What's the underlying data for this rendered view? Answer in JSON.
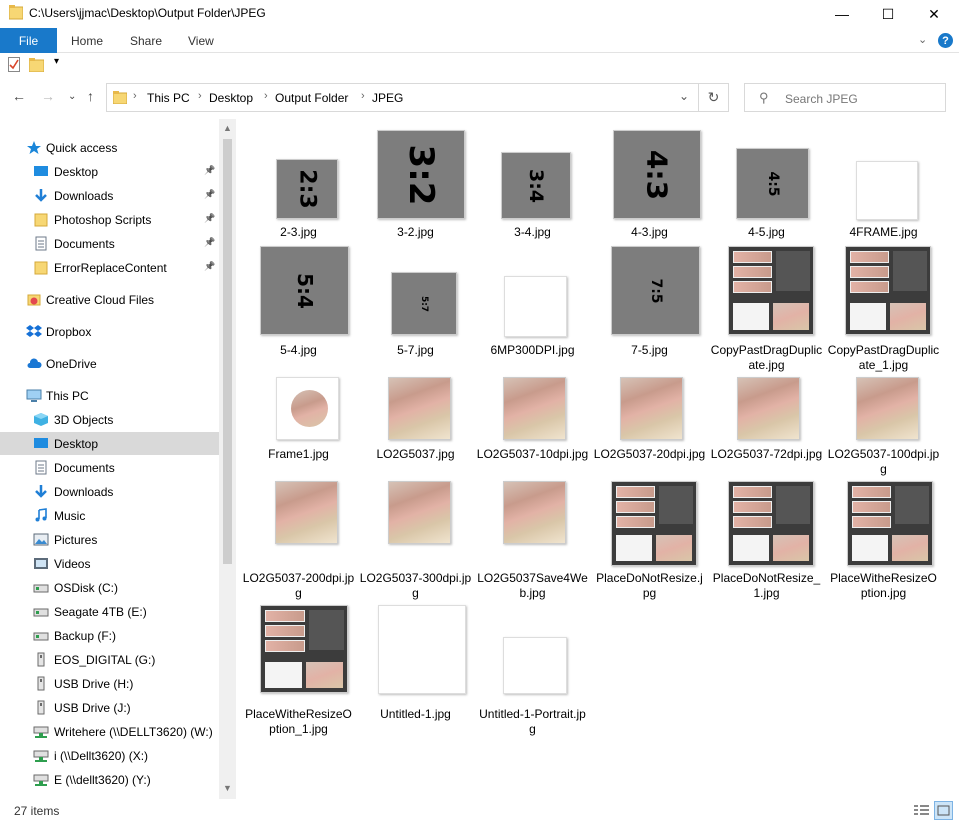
{
  "window": {
    "title": "C:\\Users\\jjmac\\Desktop\\Output Folder\\JPEG",
    "minimize": "—",
    "maximize": "☐",
    "close": "✕"
  },
  "ribbon": {
    "tabs": [
      "File",
      "Home",
      "Share",
      "View"
    ],
    "help": "?"
  },
  "address": {
    "crumbs": [
      "This PC",
      "Desktop",
      "Output Folder",
      "JPEG"
    ],
    "search_placeholder": "Search JPEG"
  },
  "sidebar": {
    "items": [
      {
        "label": "Quick access",
        "icon": "star-icon",
        "pinned": false
      },
      {
        "label": "Desktop",
        "icon": "desktop-icon",
        "pinned": true
      },
      {
        "label": "Downloads",
        "icon": "download-icon",
        "pinned": true
      },
      {
        "label": "Photoshop Scripts",
        "icon": "folder-icon",
        "pinned": true
      },
      {
        "label": "Documents",
        "icon": "documents-icon",
        "pinned": true
      },
      {
        "label": "ErrorReplaceContent",
        "icon": "folder-icon",
        "pinned": true
      },
      {
        "label": "Creative Cloud Files",
        "icon": "creative-cloud-icon",
        "pinned": false
      },
      {
        "label": "Dropbox",
        "icon": "dropbox-icon",
        "pinned": false
      },
      {
        "label": "OneDrive",
        "icon": "cloud-icon",
        "pinned": false
      },
      {
        "label": "This PC",
        "icon": "computer-icon",
        "pinned": false
      },
      {
        "label": "3D Objects",
        "icon": "cube-icon",
        "pinned": false
      },
      {
        "label": "Desktop",
        "icon": "desktop-icon",
        "pinned": false,
        "selected": true
      },
      {
        "label": "Documents",
        "icon": "documents-icon",
        "pinned": false
      },
      {
        "label": "Downloads",
        "icon": "download-icon",
        "pinned": false
      },
      {
        "label": "Music",
        "icon": "music-icon",
        "pinned": false
      },
      {
        "label": "Pictures",
        "icon": "pictures-icon",
        "pinned": false
      },
      {
        "label": "Videos",
        "icon": "video-icon",
        "pinned": false
      },
      {
        "label": "OSDisk (C:)",
        "icon": "drive-icon",
        "pinned": false
      },
      {
        "label": "Seagate 4TB (E:)",
        "icon": "drive-icon",
        "pinned": false
      },
      {
        "label": "Backup (F:)",
        "icon": "drive-icon",
        "pinned": false
      },
      {
        "label": "EOS_DIGITAL (G:)",
        "icon": "usb-drive-icon",
        "pinned": false
      },
      {
        "label": "USB Drive (H:)",
        "icon": "usb-drive-icon",
        "pinned": false
      },
      {
        "label": "USB Drive (J:)",
        "icon": "usb-drive-icon",
        "pinned": false
      },
      {
        "label": "Writehere (\\\\DELLT3620) (W:)",
        "icon": "network-drive-icon",
        "pinned": false
      },
      {
        "label": "i (\\\\Dellt3620) (X:)",
        "icon": "network-drive-icon",
        "pinned": false
      },
      {
        "label": "E (\\\\dellt3620) (Y:)",
        "icon": "network-drive-icon",
        "pinned": false
      }
    ]
  },
  "files": [
    {
      "name": "2-3.jpg",
      "kind": "ratio",
      "ratio": "2:3"
    },
    {
      "name": "3-2.jpg",
      "kind": "ratio",
      "ratio": "3:2"
    },
    {
      "name": "3-4.jpg",
      "kind": "ratio",
      "ratio": "3:4"
    },
    {
      "name": "4-3.jpg",
      "kind": "ratio",
      "ratio": "4:3"
    },
    {
      "name": "4-5.jpg",
      "kind": "ratio",
      "ratio": "4:5"
    },
    {
      "name": "4FRAME.jpg",
      "kind": "white"
    },
    {
      "name": "5-4.jpg",
      "kind": "ratio",
      "ratio": "5:4"
    },
    {
      "name": "5-7.jpg",
      "kind": "ratio",
      "ratio": "5:7"
    },
    {
      "name": "6MP300DPI.jpg",
      "kind": "white"
    },
    {
      "name": "7-5.jpg",
      "kind": "ratio",
      "ratio": "7:5"
    },
    {
      "name": "CopyPastDragDuplicate.jpg",
      "kind": "ps"
    },
    {
      "name": "CopyPastDragDuplicate_1.jpg",
      "kind": "ps"
    },
    {
      "name": "Frame1.jpg",
      "kind": "frame"
    },
    {
      "name": "LO2G5037.jpg",
      "kind": "photo"
    },
    {
      "name": "LO2G5037-10dpi.jpg",
      "kind": "photo"
    },
    {
      "name": "LO2G5037-20dpi.jpg",
      "kind": "photo"
    },
    {
      "name": "LO2G5037-72dpi.jpg",
      "kind": "photo"
    },
    {
      "name": "LO2G5037-100dpi.jpg",
      "kind": "photo"
    },
    {
      "name": "LO2G5037-200dpi.jpg",
      "kind": "photo"
    },
    {
      "name": "LO2G5037-300dpi.jpg",
      "kind": "photo"
    },
    {
      "name": "LO2G5037Save4Web.jpg",
      "kind": "photo"
    },
    {
      "name": "PlaceDoNotResize.jpg",
      "kind": "ps"
    },
    {
      "name": "PlaceDoNotResize_1.jpg",
      "kind": "ps"
    },
    {
      "name": "PlaceWitheResizeOption.jpg",
      "kind": "ps"
    },
    {
      "name": "PlaceWitheResizeOption_1.jpg",
      "kind": "ps"
    },
    {
      "name": "Untitled-1.jpg",
      "kind": "white"
    },
    {
      "name": "Untitled-1-Portrait.jpg",
      "kind": "white"
    }
  ],
  "status": {
    "count": "27 items"
  },
  "colors": {
    "accent": "#1979ca",
    "selected": "#d9d9d9",
    "ratio_gray": "#7d7d7d"
  }
}
